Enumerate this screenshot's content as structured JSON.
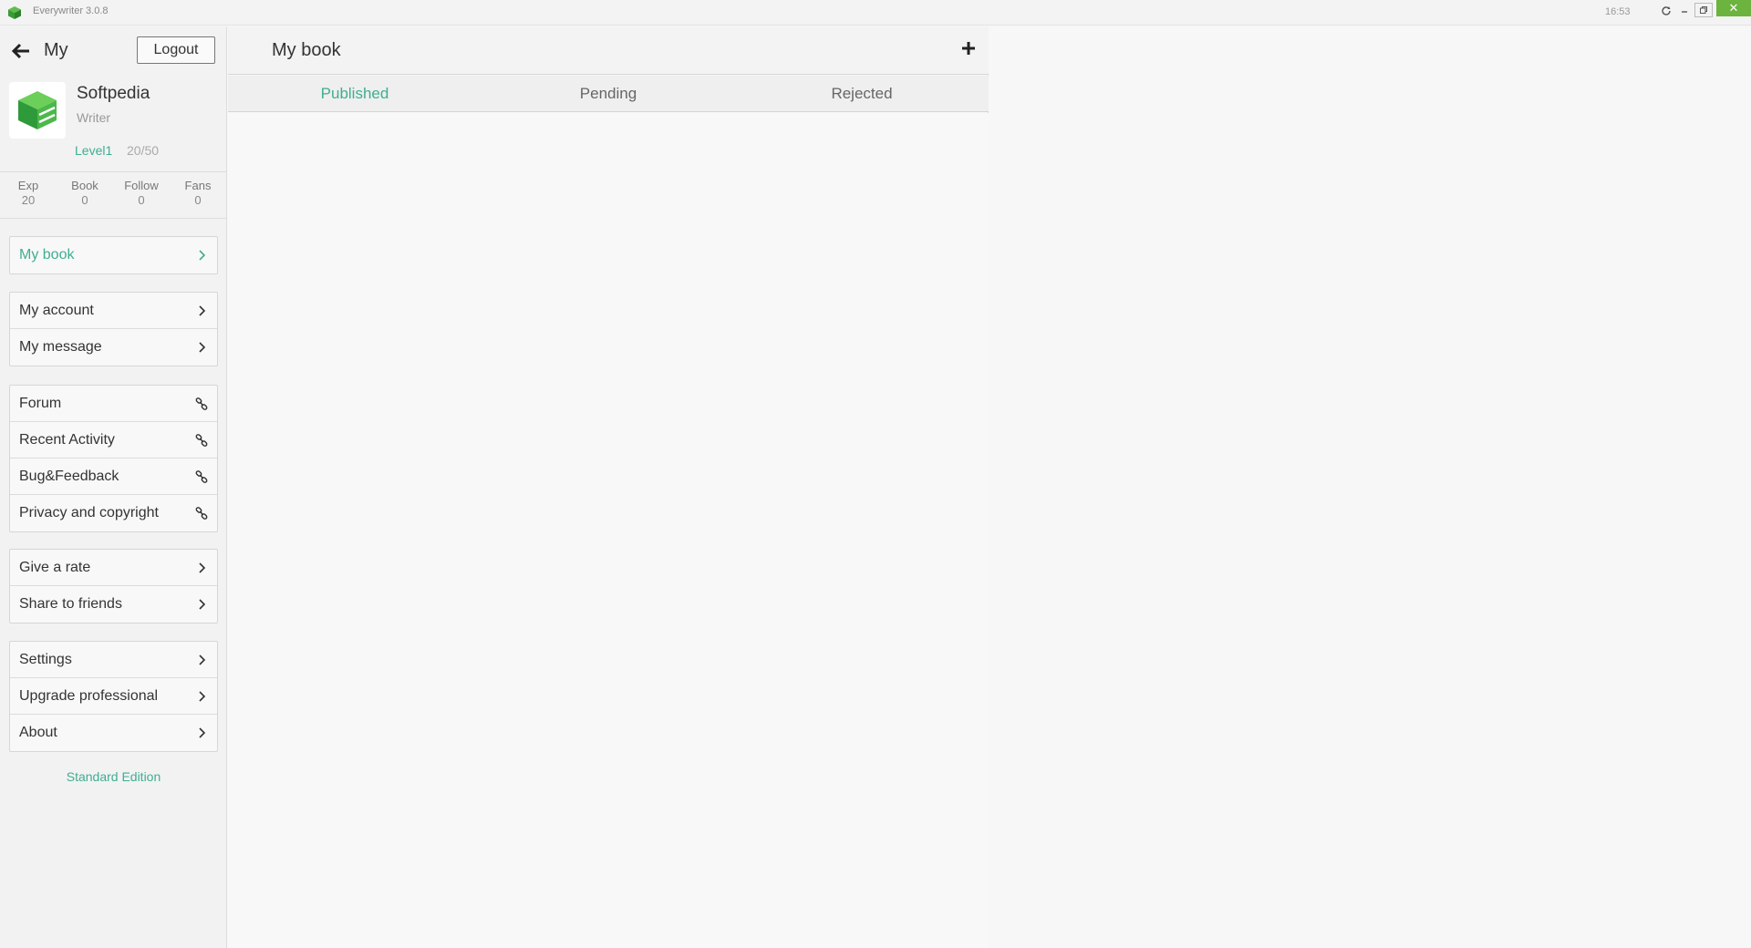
{
  "window": {
    "title": "Everywriter  3.0.8",
    "clock": "16:53",
    "close_glyph": "✕"
  },
  "sidebar": {
    "title": "My",
    "logout_label": "Logout",
    "profile": {
      "name": "Softpedia",
      "role": "Writer",
      "level": "Level1",
      "progress": "20/50"
    },
    "stats": [
      {
        "label": "Exp",
        "value": "20"
      },
      {
        "label": "Book",
        "value": "0"
      },
      {
        "label": "Follow",
        "value": "0"
      },
      {
        "label": "Fans",
        "value": "0"
      }
    ],
    "groups": [
      [
        {
          "label": "My book",
          "icon": "chevron-right-icon",
          "active": true
        }
      ],
      [
        {
          "label": "My account",
          "icon": "chevron-right-icon"
        },
        {
          "label": "My message",
          "icon": "chevron-right-icon"
        }
      ],
      [
        {
          "label": "Forum",
          "icon": "link-icon"
        },
        {
          "label": "Recent Activity",
          "icon": "link-icon"
        },
        {
          "label": "Bug&Feedback",
          "icon": "link-icon"
        },
        {
          "label": "Privacy and copyright",
          "icon": "link-icon"
        }
      ],
      [
        {
          "label": "Give a rate",
          "icon": "chevron-right-icon"
        },
        {
          "label": "Share to friends",
          "icon": "chevron-right-icon"
        }
      ],
      [
        {
          "label": "Settings",
          "icon": "chevron-right-icon"
        },
        {
          "label": "Upgrade professional",
          "icon": "chevron-right-icon"
        },
        {
          "label": "About",
          "icon": "chevron-right-icon"
        }
      ]
    ],
    "edition": "Standard Edition"
  },
  "main": {
    "title": "My book",
    "tabs": [
      {
        "label": "Published",
        "active": true
      },
      {
        "label": "Pending"
      },
      {
        "label": "Rejected"
      }
    ]
  },
  "colors": {
    "accent": "#3fae91",
    "close_button": "#6db33f"
  }
}
